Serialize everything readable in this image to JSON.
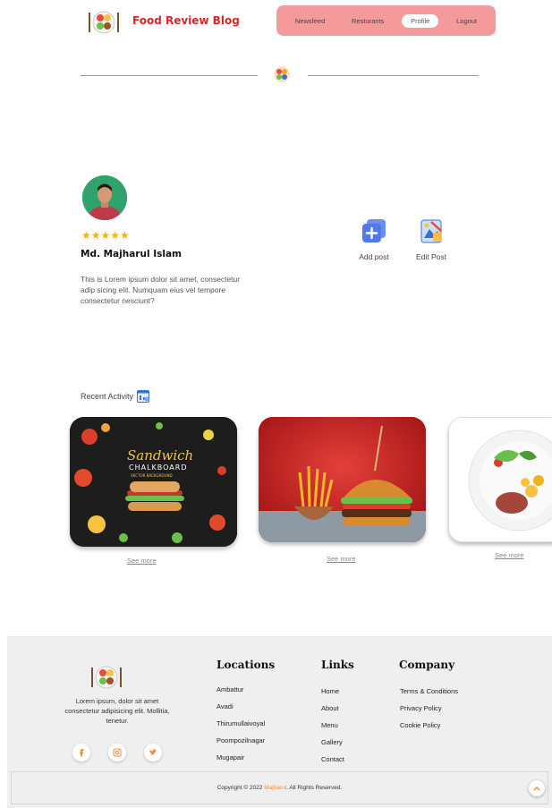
{
  "header": {
    "brand": "Food Review Blog",
    "nav": [
      "Newsfeed",
      "Resturants",
      "Profile",
      "Logout"
    ],
    "active_nav": "Profile"
  },
  "profile": {
    "rating_stars": 5,
    "stars_text": "★★★★★",
    "name": "Md. Majharul Islam",
    "bio": "This is Lorem ipsum dolor sit amet, consectetur adip sicing elit. Numquam eius vel tempore consectetur nesciunt?"
  },
  "actions": {
    "add_post": "Add post",
    "edit_post": "Edit Post"
  },
  "recent": {
    "title": "Recent Activity",
    "cards": [
      {
        "see_more": "See more",
        "image": "sandwich-chalkboard-image",
        "poster_title": "Sandwich",
        "poster_subtitle": "CHALKBOARD",
        "poster_caption": "VECTOR BACKGROUND"
      },
      {
        "see_more": "See more",
        "image": "burger-and-fries-image"
      },
      {
        "see_more": "See more",
        "image": "steak-salad-plate-image"
      }
    ]
  },
  "footer": {
    "about": "Lorem ipsum, dolor sit amet consectetur adipisicing elit. Mollitia, tenetur.",
    "social": [
      "facebook-icon",
      "instagram-icon",
      "twitter-icon"
    ],
    "locations": {
      "title": "Locations",
      "items": [
        "Ambattur",
        "Avadi",
        "Thirumullaivoyal",
        "Poompozilnagar",
        "Mugapair"
      ]
    },
    "links": {
      "title": "Links",
      "items": [
        "Home",
        "About",
        "Menu",
        "Gallery",
        "Contact"
      ]
    },
    "company": {
      "title": "Company",
      "items": [
        "Terms & Conditions",
        "Privacy Policy",
        "Cookie Policy"
      ]
    },
    "copyright_prefix": "Copyright © 2022 ",
    "copyright_name": "Majharul",
    "copyright_suffix": ". All Rights Reserved."
  },
  "colors": {
    "brand_red": "#d9252b",
    "nav_bg": "#f59a9a",
    "star": "#f2b21a",
    "accent_orange": "#f08c3a",
    "footer_bg": "#efefef"
  }
}
